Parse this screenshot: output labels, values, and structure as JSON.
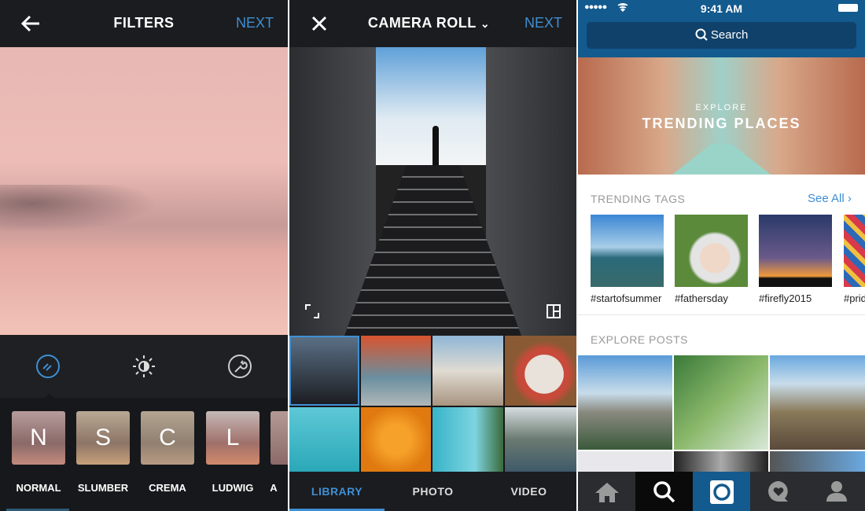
{
  "filters_screen": {
    "title": "FILTERS",
    "next": "NEXT",
    "tools": [
      "filter-icon",
      "brightness-icon",
      "wrench-icon"
    ],
    "filters": [
      {
        "letter": "N",
        "label": "NORMAL"
      },
      {
        "letter": "S",
        "label": "SLUMBER"
      },
      {
        "letter": "C",
        "label": "CREMA"
      },
      {
        "letter": "L",
        "label": "LUDWIG"
      },
      {
        "letter": "",
        "label": "A"
      }
    ],
    "selected_filter": "NORMAL"
  },
  "camera_roll": {
    "title": "CAMERA ROLL",
    "next": "NEXT",
    "tabs": [
      "LIBRARY",
      "PHOTO",
      "VIDEO"
    ],
    "active_tab": "LIBRARY"
  },
  "explore": {
    "status": {
      "time": "9:41 AM"
    },
    "search_placeholder": "Search",
    "banner": {
      "kicker": "EXPLORE",
      "title": "TRENDING PLACES"
    },
    "trending_tags": {
      "heading": "TRENDING TAGS",
      "see_all": "See All",
      "tags": [
        "#startofsummer",
        "#fathersday",
        "#firefly2015",
        "#pride"
      ]
    },
    "explore_posts": {
      "heading": "EXPLORE POSTS"
    },
    "nav": [
      "home-icon",
      "search-icon",
      "camera-icon",
      "activity-icon",
      "profile-icon"
    ],
    "active_nav": "search-icon",
    "accent": "#125688"
  }
}
